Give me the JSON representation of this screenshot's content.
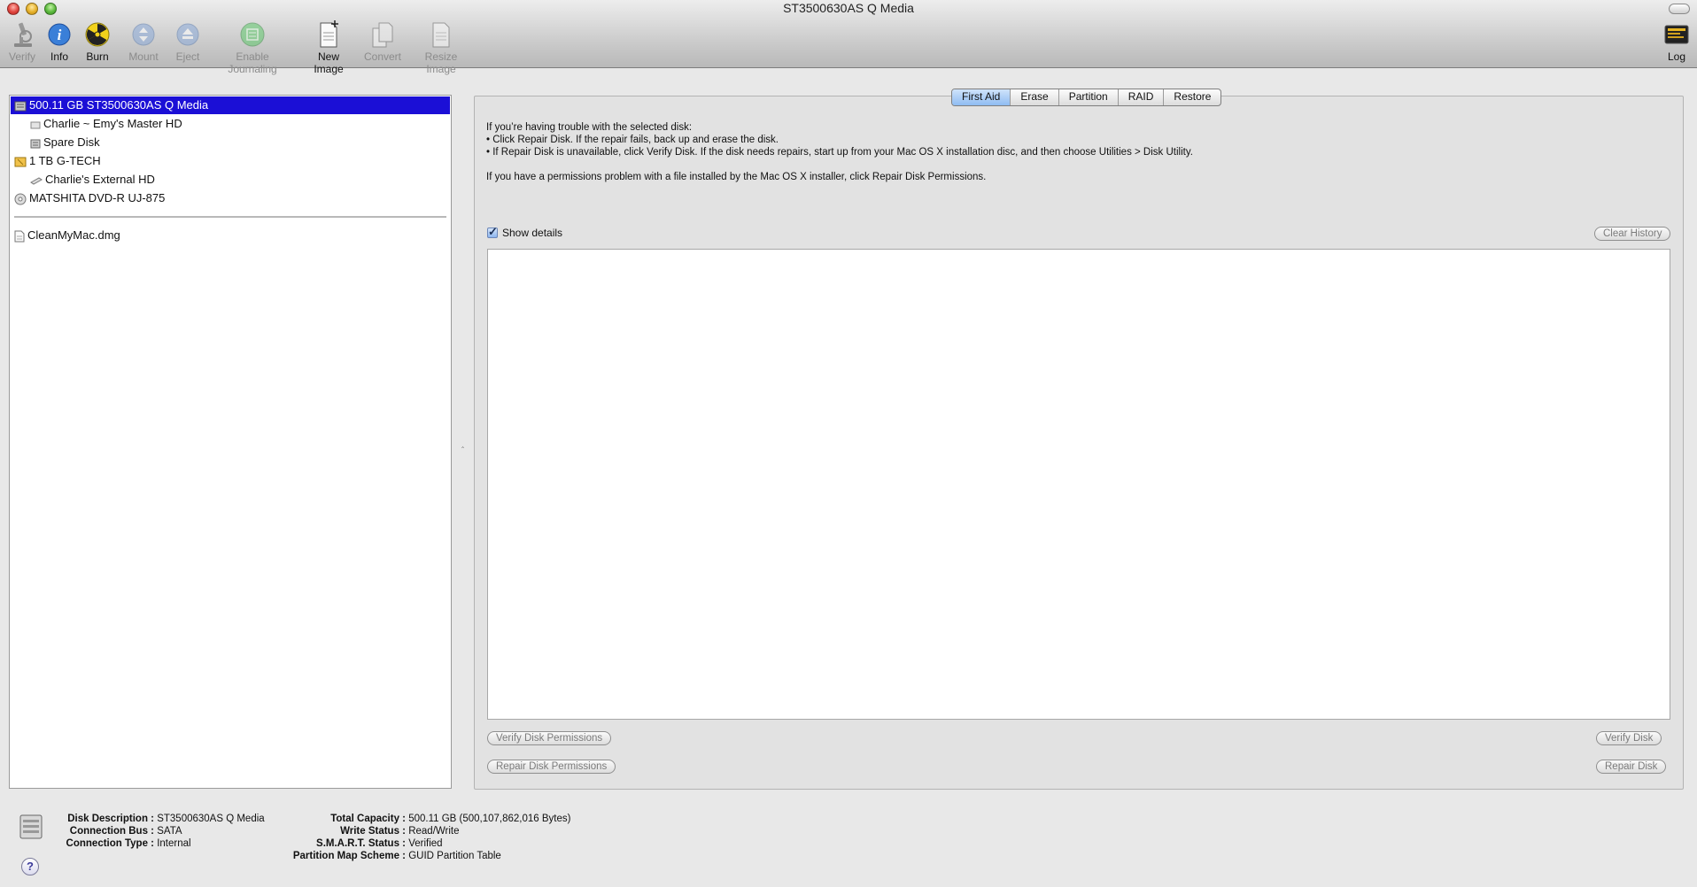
{
  "window": {
    "title": "ST3500630AS Q Media"
  },
  "toolbar": {
    "items": [
      {
        "label": "Verify",
        "icon": "microscope-icon",
        "enabled": false
      },
      {
        "label": "Info",
        "icon": "info-icon",
        "enabled": true
      },
      {
        "label": "Burn",
        "icon": "burn-icon",
        "enabled": true
      },
      {
        "label": "Mount",
        "icon": "mount-icon",
        "enabled": false
      },
      {
        "label": "Eject",
        "icon": "eject-icon",
        "enabled": false
      },
      {
        "label": "Enable Journaling",
        "icon": "journaling-icon",
        "enabled": false
      },
      {
        "label": "New Image",
        "icon": "new-image-icon",
        "enabled": true
      },
      {
        "label": "Convert",
        "icon": "convert-icon",
        "enabled": false
      },
      {
        "label": "Resize Image",
        "icon": "resize-image-icon",
        "enabled": false
      }
    ],
    "log_label": "Log"
  },
  "sidebar": {
    "items": [
      {
        "label": "500.11 GB ST3500630AS Q Media",
        "icon": "internal-disk-icon",
        "selected": true
      },
      {
        "label": "Charlie ~ Emy's Master HD",
        "icon": "volume-icon",
        "selected": false
      },
      {
        "label": "Spare Disk",
        "icon": "volume-icon",
        "selected": false
      },
      {
        "label": "1 TB G-TECH",
        "icon": "external-disk-icon",
        "selected": false
      },
      {
        "label": "Charlie's External HD",
        "icon": "volume-icon",
        "selected": false
      },
      {
        "label": "MATSHITA DVD-R UJ-875",
        "icon": "optical-drive-icon",
        "selected": false
      },
      {
        "label": "CleanMyMac.dmg",
        "icon": "disk-image-icon",
        "selected": false
      }
    ]
  },
  "tabs": [
    {
      "label": "First Aid",
      "active": true
    },
    {
      "label": "Erase",
      "active": false
    },
    {
      "label": "Partition",
      "active": false
    },
    {
      "label": "RAID",
      "active": false
    },
    {
      "label": "Restore",
      "active": false
    }
  ],
  "first_aid": {
    "intro": "If you’re having trouble with the selected disk:",
    "bullet1": "• Click Repair Disk. If the repair fails, back up and erase the disk.",
    "bullet2": "• If Repair Disk is unavailable, click Verify Disk. If the disk needs repairs, start up from your Mac OS X installation disc, and then choose Utilities > Disk Utility.",
    "permissions_note": "If you have a permissions problem with a file installed by the Mac OS X installer, click Repair Disk Permissions.",
    "show_details_label": "Show details",
    "show_details_checked": true,
    "clear_history_label": "Clear History",
    "verify_permissions_label": "Verify Disk Permissions",
    "repair_permissions_label": "Repair Disk Permissions",
    "verify_disk_label": "Verify Disk",
    "repair_disk_label": "Repair Disk"
  },
  "disk_info": {
    "left": [
      {
        "key": "Disk Description :",
        "value": "ST3500630AS Q Media"
      },
      {
        "key": "Connection Bus :",
        "value": "SATA"
      },
      {
        "key": "Connection Type :",
        "value": "Internal"
      }
    ],
    "right": [
      {
        "key": "Total Capacity :",
        "value": "500.11 GB (500,107,862,016 Bytes)"
      },
      {
        "key": "Write Status :",
        "value": "Read/Write"
      },
      {
        "key": "S.M.A.R.T. Status :",
        "value": "Verified"
      },
      {
        "key": "Partition Map Scheme :",
        "value": "GUID Partition Table"
      }
    ],
    "help_glyph": "?"
  },
  "colors": {
    "selection": "#1b0fd6",
    "active_tab": "#8fbcf2"
  }
}
